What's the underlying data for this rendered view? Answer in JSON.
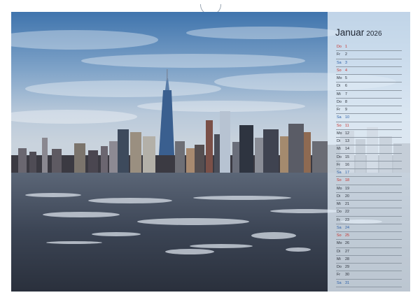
{
  "calendar": {
    "month": "Januar",
    "year": "2026",
    "days": [
      {
        "weekday": "Do",
        "date": "1",
        "type": "holiday"
      },
      {
        "weekday": "Fr",
        "date": "2",
        "type": "weekday"
      },
      {
        "weekday": "Sa",
        "date": "3",
        "type": "saturday"
      },
      {
        "weekday": "So",
        "date": "4",
        "type": "sunday"
      },
      {
        "weekday": "Mo",
        "date": "5",
        "type": "weekday"
      },
      {
        "weekday": "Di",
        "date": "6",
        "type": "weekday"
      },
      {
        "weekday": "Mi",
        "date": "7",
        "type": "weekday"
      },
      {
        "weekday": "Do",
        "date": "8",
        "type": "weekday"
      },
      {
        "weekday": "Fr",
        "date": "9",
        "type": "weekday"
      },
      {
        "weekday": "Sa",
        "date": "10",
        "type": "saturday"
      },
      {
        "weekday": "So",
        "date": "11",
        "type": "sunday"
      },
      {
        "weekday": "Mo",
        "date": "12",
        "type": "weekday"
      },
      {
        "weekday": "Di",
        "date": "13",
        "type": "weekday"
      },
      {
        "weekday": "Mi",
        "date": "14",
        "type": "weekday"
      },
      {
        "weekday": "Do",
        "date": "15",
        "type": "weekday"
      },
      {
        "weekday": "Fr",
        "date": "16",
        "type": "weekday"
      },
      {
        "weekday": "Sa",
        "date": "17",
        "type": "saturday"
      },
      {
        "weekday": "So",
        "date": "18",
        "type": "sunday"
      },
      {
        "weekday": "Mo",
        "date": "19",
        "type": "weekday"
      },
      {
        "weekday": "Di",
        "date": "20",
        "type": "weekday"
      },
      {
        "weekday": "Mi",
        "date": "21",
        "type": "weekday"
      },
      {
        "weekday": "Do",
        "date": "22",
        "type": "weekday"
      },
      {
        "weekday": "Fr",
        "date": "23",
        "type": "weekday"
      },
      {
        "weekday": "Sa",
        "date": "24",
        "type": "saturday"
      },
      {
        "weekday": "So",
        "date": "25",
        "type": "sunday"
      },
      {
        "weekday": "Mo",
        "date": "26",
        "type": "weekday"
      },
      {
        "weekday": "Di",
        "date": "27",
        "type": "weekday"
      },
      {
        "weekday": "Mi",
        "date": "28",
        "type": "weekday"
      },
      {
        "weekday": "Do",
        "date": "29",
        "type": "weekday"
      },
      {
        "weekday": "Fr",
        "date": "30",
        "type": "weekday"
      },
      {
        "weekday": "Sa",
        "date": "31",
        "type": "saturday"
      }
    ]
  },
  "colors": {
    "sunday": "#c8312b",
    "saturday": "#2b5fa8",
    "weekday": "#2a2f38",
    "panel": "#e1ecf6",
    "sky_top": "#4a7fb6",
    "water": "#3a4352"
  }
}
